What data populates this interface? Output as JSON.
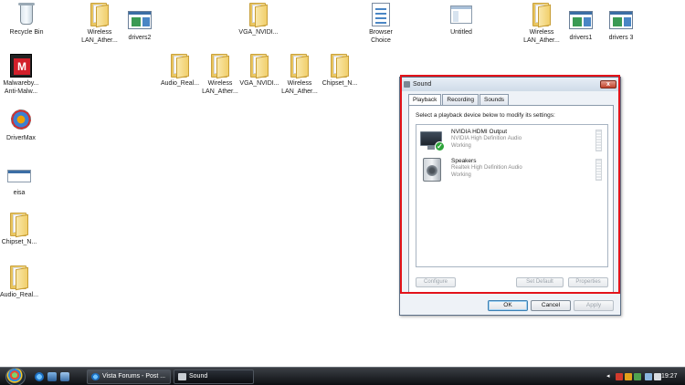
{
  "desktop": {
    "icons": [
      {
        "label": "Recycle Bin"
      },
      {
        "label": "Wireless LAN_Ather..."
      },
      {
        "label": "drivers2"
      },
      {
        "label": "VGA_NVIDI..."
      },
      {
        "label": "Browser Choice"
      },
      {
        "label": "Untitled"
      },
      {
        "label": "Wireless LAN_Ather..."
      },
      {
        "label": "drivers1"
      },
      {
        "label": "drivers 3"
      },
      {
        "label": "Malwareby... Anti-Malw..."
      },
      {
        "label": "Audio_Real..."
      },
      {
        "label": "Wireless LAN_Ather..."
      },
      {
        "label": "VGA_NVIDI..."
      },
      {
        "label": "Wireless LAN_Ather..."
      },
      {
        "label": "Chipset_N..."
      },
      {
        "label": "DriverMax"
      },
      {
        "label": "eisa"
      },
      {
        "label": "Chipset_N..."
      },
      {
        "label": "Audio_Real..."
      }
    ]
  },
  "dialog": {
    "title": "Sound",
    "close_glyph": "x",
    "tabs": [
      "Playback",
      "Recording",
      "Sounds"
    ],
    "active_tab": "Playback",
    "instruction": "Select a playback device below to modify its settings:",
    "devices": [
      {
        "name": "NVIDIA HDMI Output",
        "driver": "NVIDIA High Definition Audio",
        "status": "Working",
        "icon": "monitor-icon",
        "default": true
      },
      {
        "name": "Speakers",
        "driver": "Realtek High Definition Audio",
        "status": "Working",
        "icon": "speaker-icon",
        "default": false
      }
    ],
    "panel_buttons": {
      "configure": "Configure",
      "set_default": "Set Default",
      "properties": "Properties"
    },
    "buttons": {
      "ok": "OK",
      "cancel": "Cancel",
      "apply": "Apply"
    },
    "highlight_color": "#e3131a"
  },
  "taskbar": {
    "windows": [
      {
        "label": "Vista Forums - Post ...",
        "icon": "ie-icon"
      },
      {
        "label": "Sound",
        "icon": "speaker-icon"
      }
    ],
    "clock": "19:27"
  }
}
